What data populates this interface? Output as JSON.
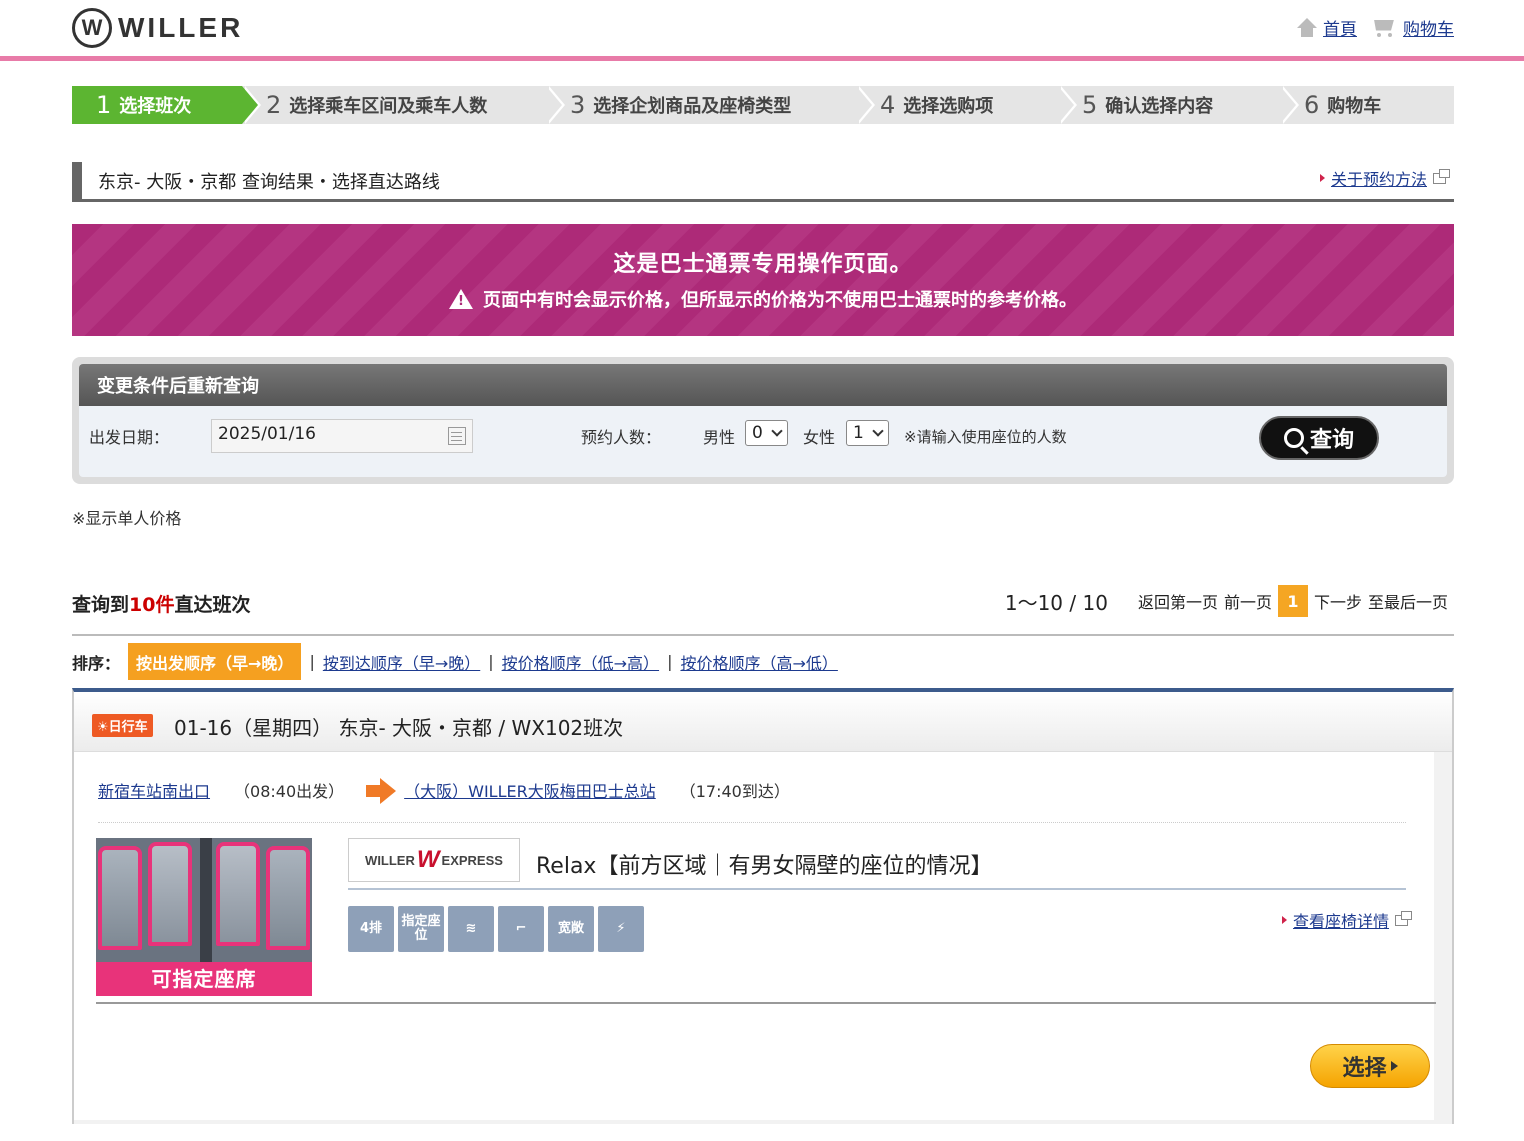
{
  "header": {
    "logo_mark": "W",
    "logo_text": "WILLER",
    "home_label": "首頁",
    "cart_label": "购物车"
  },
  "steps": [
    {
      "num": "1",
      "label": "选择班次",
      "active": true
    },
    {
      "num": "2",
      "label": "选择乘车区间及乘车人数",
      "active": false
    },
    {
      "num": "3",
      "label": "选择企划商品及座椅类型",
      "active": false
    },
    {
      "num": "4",
      "label": "选择选购项",
      "active": false
    },
    {
      "num": "5",
      "label": "确认选择内容",
      "active": false
    },
    {
      "num": "6",
      "label": "购物车",
      "active": false
    }
  ],
  "page_title": "东京- 大阪・京都  查询结果・选择直达路线",
  "help_link": "关于预约方法",
  "banner": {
    "line1": "这是巴士通票专用操作页面。",
    "line2": "页面中有时会显示价格，但所显示的价格为不使用巴士通票时的参考价格。",
    "warn_glyph": "!"
  },
  "search": {
    "heading": "变更条件后重新查询",
    "date_label": "出发日期：",
    "date_value": "2025/01/16",
    "people_label": "预约人数：",
    "male_label": "男性",
    "male_value": "0",
    "female_label": "女性",
    "female_value": "1",
    "note": "※请输入使用座位的人数",
    "button_label": "查询"
  },
  "price_note": "※显示单人价格",
  "results": {
    "prefix": "查询到",
    "count": "10件",
    "suffix": "直达班次",
    "range": "1～10 / 10",
    "first_page": "返回第一页",
    "prev_page": "前一页",
    "current_page": "1",
    "next_page": "下一步",
    "last_page": "至最后一页"
  },
  "sort": {
    "label": "排序：",
    "options": [
      "按出发顺序（早→晚）",
      "按到达顺序（早→晚）",
      "按价格顺序（低→高）",
      "按价格顺序（高→低）"
    ],
    "separator": "|"
  },
  "trip": {
    "badge": "☀日行车",
    "title": "01-16（星期四） 东京- 大阪・京都 / WX102班次",
    "depart_stop": "新宿车站南出口",
    "depart_time": "（08:40出发）",
    "arrive_stop": "（大阪）WILLER大阪梅田巴士总站",
    "arrive_time": "（17:40到达）",
    "image_caption": "可指定座席",
    "brand_left": "WILLER",
    "brand_w": "W",
    "brand_right": "EXPRESS",
    "plan_name": "Relax【前方区域｜有男女隔壁的座位的情况】",
    "features": [
      "4排",
      "指定座位",
      "≋",
      "⌐",
      "宽敞",
      "⚡"
    ],
    "seat_detail_link": "查看座椅详情",
    "select_button": "选择"
  },
  "colors": {
    "accent_pink": "#e87ba8",
    "step_active": "#5cb531",
    "banner": "#ad2a78",
    "orange": "#f5a623"
  }
}
